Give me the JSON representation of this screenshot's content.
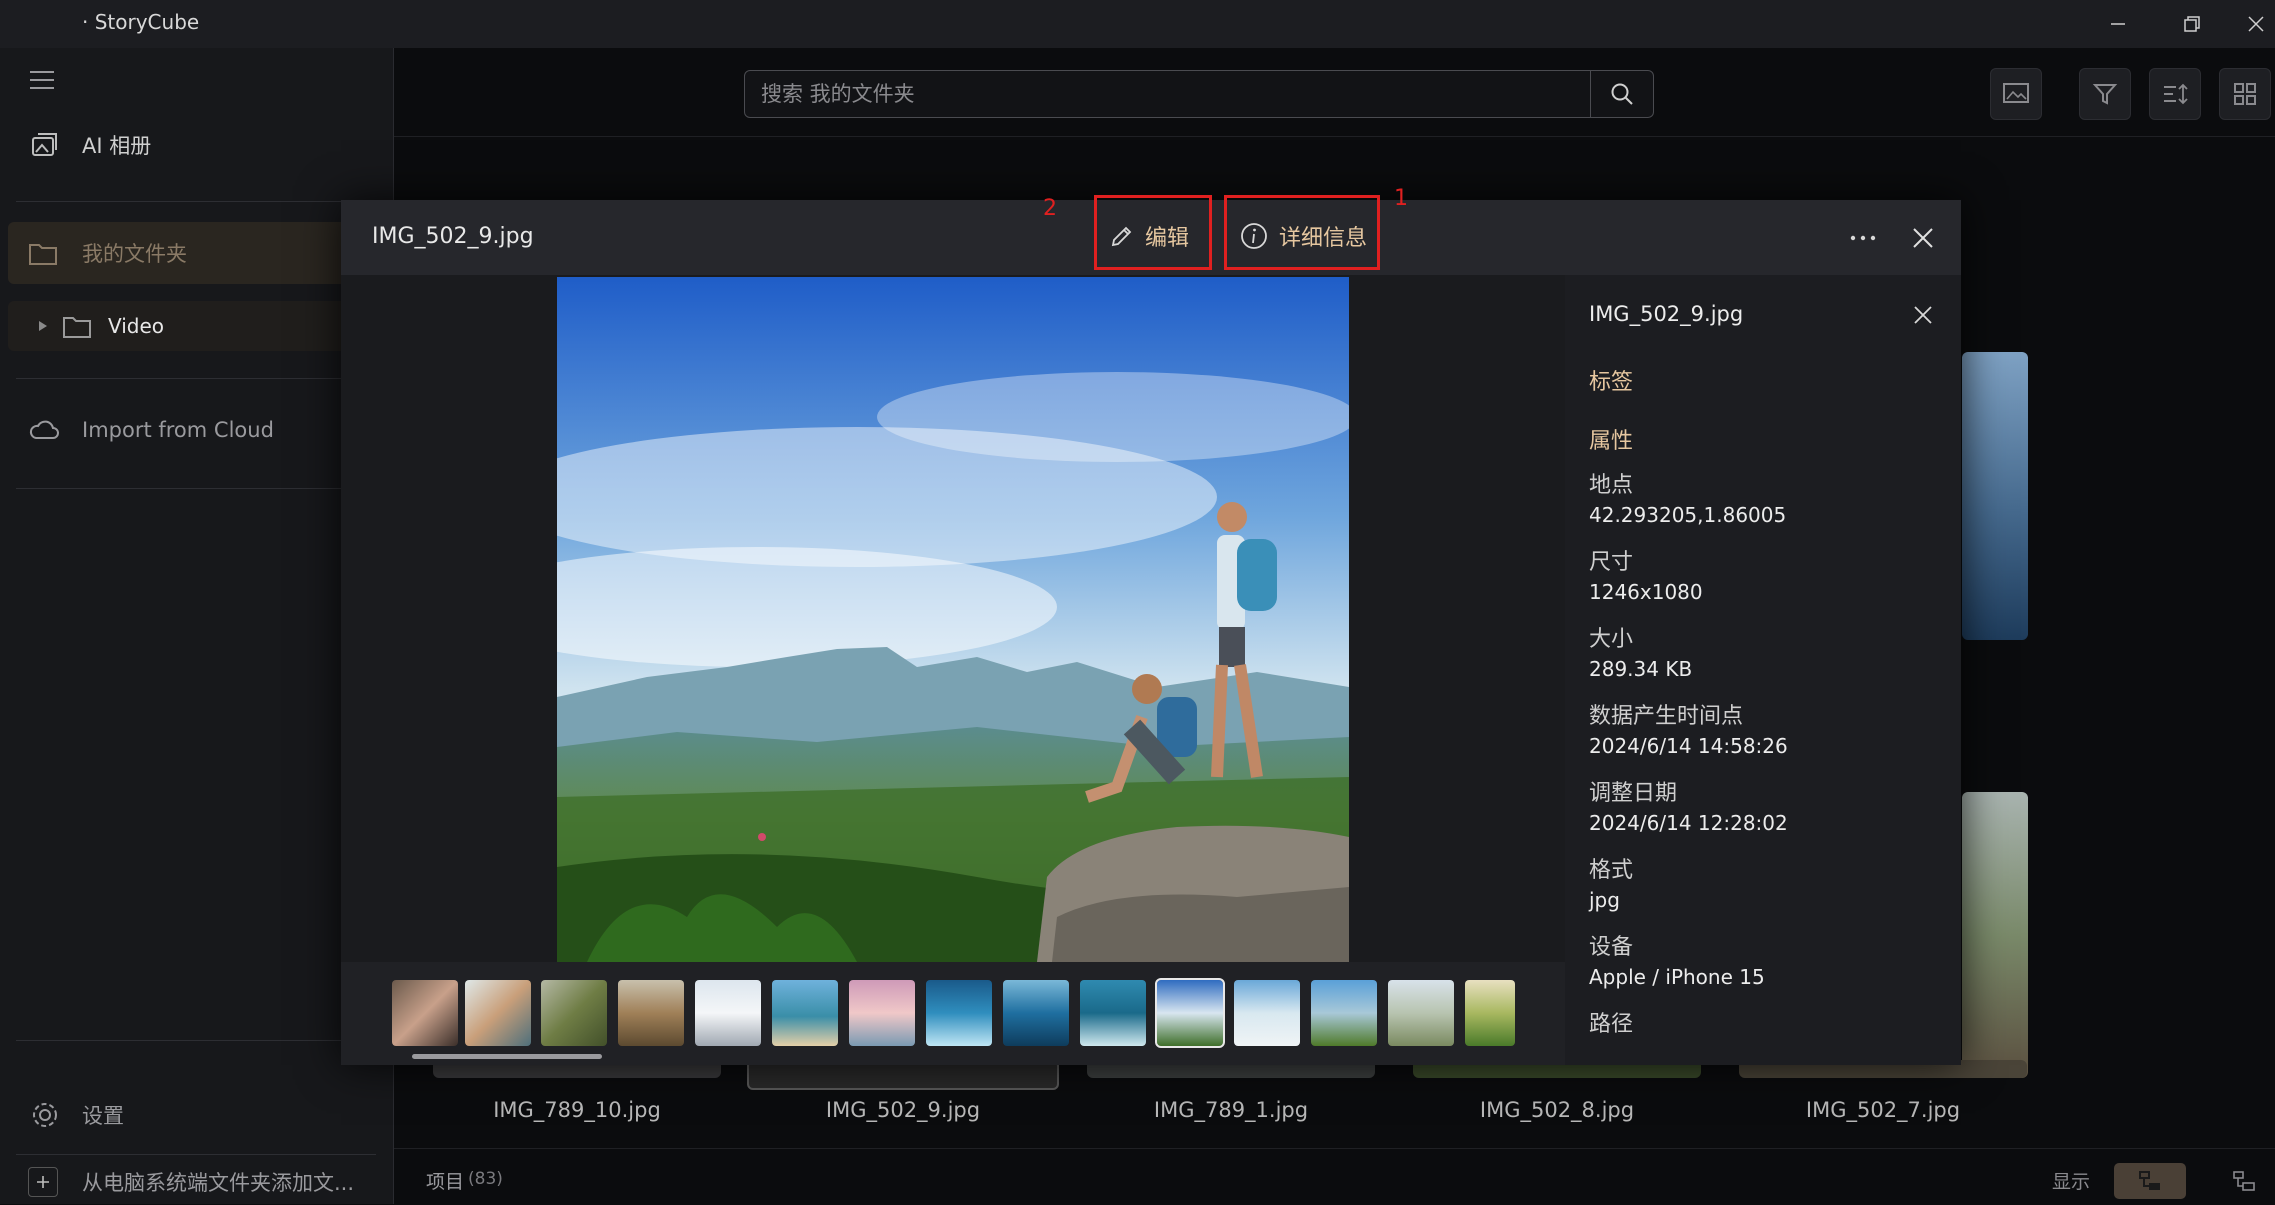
{
  "app": {
    "title": "· StoryCube"
  },
  "sidebar": {
    "items": [
      {
        "label": "AI 相册",
        "icon": "ai-album-icon"
      },
      {
        "label": "我的文件夹",
        "icon": "folder-icon"
      },
      {
        "label": "Video",
        "icon": "folder-icon"
      },
      {
        "label": "Import from Cloud",
        "icon": "cloud-icon"
      }
    ],
    "settings_label": "设置",
    "add_folder_label": "从电脑系统端文件夹添加文..."
  },
  "search": {
    "placeholder": "搜索 我的文件夹"
  },
  "grid": {
    "thumbnails": [
      {
        "name": "IMG_789_10.jpg"
      },
      {
        "name": "IMG_502_9.jpg"
      },
      {
        "name": "IMG_789_1.jpg"
      },
      {
        "name": "IMG_502_8.jpg"
      },
      {
        "name": "IMG_502_7.jpg"
      }
    ]
  },
  "status": {
    "items_label": "项目",
    "items_count": "(83)",
    "display_label": "显示"
  },
  "modal": {
    "title": "IMG_502_9.jpg",
    "edit_label": "编辑",
    "details_label": "详细信息",
    "annotation_1": "1",
    "annotation_2": "2"
  },
  "details": {
    "file_name": "IMG_502_9.jpg",
    "tags_label": "标签",
    "properties_label": "属性",
    "location_label": "地点",
    "location_value": "42.293205,1.86005",
    "dimensions_label": "尺寸",
    "dimensions_value": "1246x1080",
    "size_label": "大小",
    "size_value": "289.34 KB",
    "created_label": "数据产生时间点",
    "created_value": "2024/6/14 14:58:26",
    "modified_label": "调整日期",
    "modified_value": "2024/6/14 12:28:02",
    "format_label": "格式",
    "format_value": "jpg",
    "device_label": "设备",
    "device_value": "Apple / iPhone 15",
    "path_label": "路径"
  },
  "colors": {
    "accent": "#e6c7a0",
    "annotation_red": "#e02020",
    "background": "#0b0c0e"
  }
}
